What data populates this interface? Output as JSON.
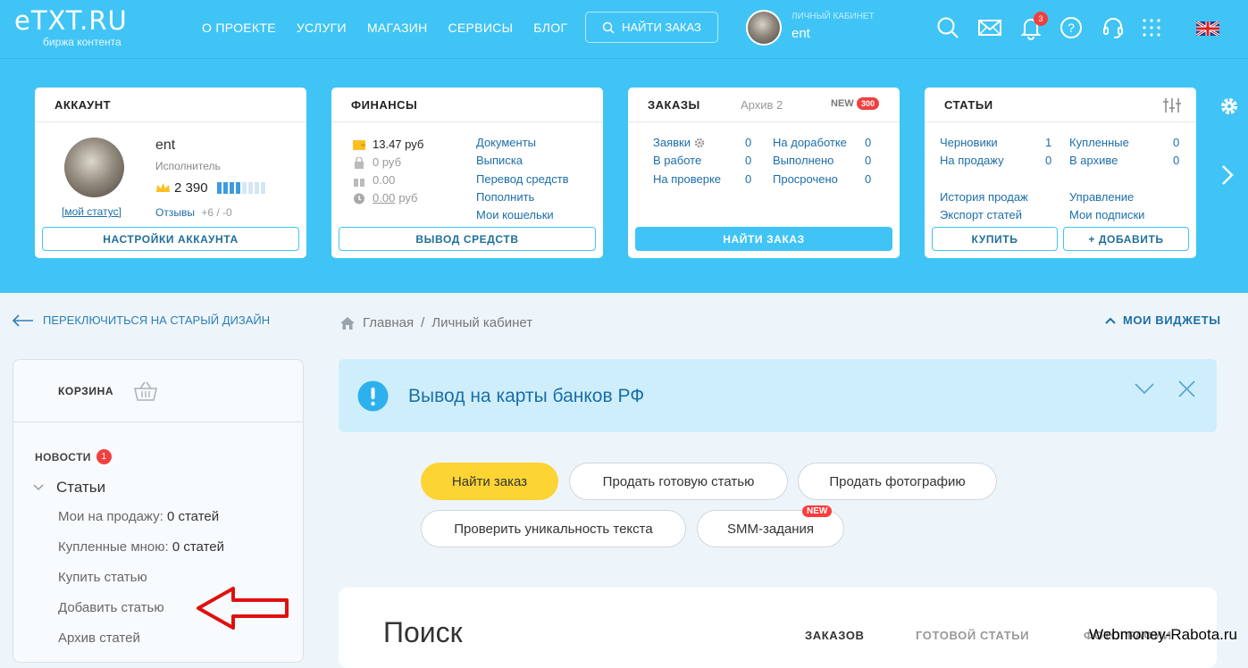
{
  "header": {
    "logo_text": "eTXT.RU",
    "logo_sub": "биржа контента",
    "nav": [
      "О ПРОЕКТЕ",
      "УСЛУГИ",
      "МАГАЗИН",
      "СЕРВИСЫ",
      "БЛОГ"
    ],
    "find_order": "НАЙТИ ЗАКАЗ",
    "cabinet_label": "ЛИЧНЫЙ КАБИНЕТ",
    "username": "ent",
    "notifications_count": "3",
    "icons": [
      "search-icon",
      "mail-icon",
      "bell-icon",
      "help-icon",
      "support-icon",
      "apps-icon",
      "uk-flag-icon"
    ]
  },
  "account": {
    "title": "АККАУНТ",
    "name": "ent",
    "role": "Исполнитель",
    "status_link": "[мой статус]",
    "rating": "2 390",
    "rating_level": 0.4,
    "reviews_label": "Отзывы",
    "reviews_value": "+6 / -0",
    "button": "НАСТРОЙКИ АККАУНТА"
  },
  "finance": {
    "title": "ФИНАНСЫ",
    "values": [
      "13.47 руб",
      "0 руб",
      "0.00",
      "0.00"
    ],
    "last_unit": "руб",
    "links": [
      "Документы",
      "Выписка",
      "Перевод средств",
      "Пополнить",
      "Мои кошельки"
    ],
    "button": "ВЫВОД СРЕДСТВ"
  },
  "orders": {
    "title": "ЗАКАЗЫ",
    "archive": "Архив 2",
    "new_label": "NEW",
    "new_count": "300",
    "left": [
      {
        "label": "Заявки",
        "value": "0"
      },
      {
        "label": "В работе",
        "value": "0"
      },
      {
        "label": "На проверке",
        "value": "0"
      }
    ],
    "right": [
      {
        "label": "На доработке",
        "value": "0"
      },
      {
        "label": "Выполнено",
        "value": "0"
      },
      {
        "label": "Просрочено",
        "value": "0"
      }
    ],
    "button": "НАЙТИ ЗАКАЗ"
  },
  "articles": {
    "title": "СТАТЬИ",
    "left": [
      {
        "label": "Черновики",
        "value": "1"
      },
      {
        "label": "На продажу",
        "value": "0"
      }
    ],
    "right": [
      {
        "label": "Купленные",
        "value": "0"
      },
      {
        "label": "В архиве",
        "value": "0"
      }
    ],
    "links_left": [
      "История продаж",
      "Экспорт статей"
    ],
    "links_right": [
      "Управление",
      "Мои подписки"
    ],
    "buy_button": "КУПИТЬ",
    "add_button": "+ ДОБАВИТЬ"
  },
  "back_link": "ПЕРЕКЛЮЧИТЬСЯ НА СТАРЫЙ ДИЗАЙН",
  "breadcrumb": {
    "home": "Главная",
    "sep": "/",
    "current": "Личный кабинет"
  },
  "my_widgets": "МОИ ВИДЖЕТЫ",
  "sidebar": {
    "cart": "КОРЗИНА",
    "news": "НОВОСТИ",
    "news_count": "1",
    "articles": "Статьи",
    "items": [
      {
        "label": "Мои на продажу: ",
        "value": "0 статей"
      },
      {
        "label": "Купленные мною: ",
        "value": "0 статей"
      },
      {
        "label": "Купить статью",
        "value": ""
      },
      {
        "label": "Добавить статью",
        "value": ""
      },
      {
        "label": "Архив статей",
        "value": ""
      }
    ]
  },
  "alert": {
    "title": "Вывод на карты банков РФ"
  },
  "actions": [
    "Найти заказ",
    "Продать готовую статью",
    "Продать фотографию",
    "Проверить уникальность текста",
    "SMM-задания"
  ],
  "smm_badge": "NEW",
  "search": {
    "title": "Поиск",
    "tabs": [
      "ЗАКАЗОВ",
      "ГОТОВОЙ СТАТЬИ",
      "ФОТОГРАФИИ"
    ]
  },
  "watermark": "Webmoney-Rabota.ru",
  "colors": {
    "primary": "#40c4f5",
    "link": "#1d6ea8",
    "badge": "#f04040",
    "yellow": "#fcd434",
    "arrow": "#e01010"
  }
}
